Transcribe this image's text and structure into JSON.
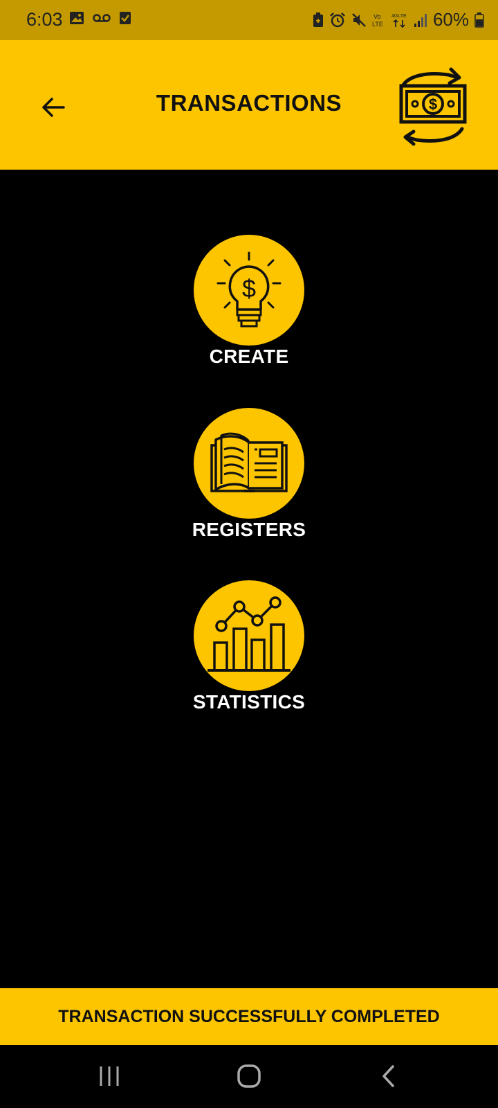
{
  "status_bar": {
    "time": "6:03",
    "battery": "60%",
    "left_icons": [
      "image-icon",
      "voicemail-icon",
      "checkbox-icon"
    ],
    "right_icons": [
      "battery-saver-icon",
      "alarm-icon",
      "mute-icon",
      "volte-icon",
      "4g-lte-icon",
      "signal-icon",
      "battery-icon"
    ],
    "network_labels": {
      "vo": "Vo",
      "lte": "LTE",
      "fourg": "4GLTE"
    }
  },
  "app_bar": {
    "title": "TRANSACTIONS",
    "back_icon": "arrow-left-icon",
    "logo_icon": "money-exchange-icon"
  },
  "menu": [
    {
      "label": "CREATE",
      "icon": "lightbulb-dollar-icon"
    },
    {
      "label": "REGISTERS",
      "icon": "open-book-icon"
    },
    {
      "label": "STATISTICS",
      "icon": "bar-line-chart-icon"
    }
  ],
  "toast": {
    "message": "TRANSACTION SUCCESSFULLY COMPLETED"
  },
  "nav_bar": {
    "items": [
      "recents-icon",
      "home-icon",
      "back-icon"
    ]
  },
  "colors": {
    "accent": "#fdc500",
    "status_bar": "#c49a00",
    "background": "#000000",
    "label": "#ffffff"
  }
}
